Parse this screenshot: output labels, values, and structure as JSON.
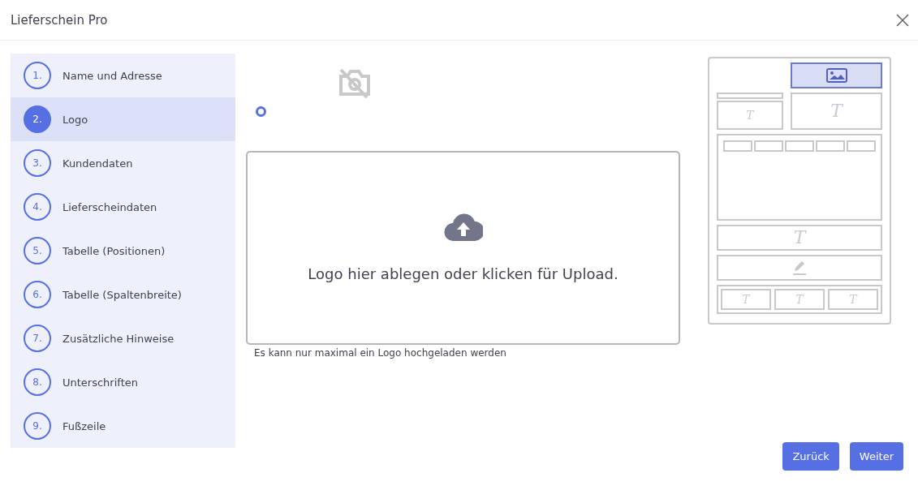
{
  "window": {
    "title": "Lieferschein Pro"
  },
  "steps": [
    {
      "number": "1.",
      "label": "Name und Adresse",
      "selected": false
    },
    {
      "number": "2.",
      "label": "Logo",
      "selected": true
    },
    {
      "number": "3.",
      "label": "Kundendaten",
      "selected": false
    },
    {
      "number": "4.",
      "label": "Lieferscheindaten",
      "selected": false
    },
    {
      "number": "5.",
      "label": "Tabelle (Positionen)",
      "selected": false
    },
    {
      "number": "6.",
      "label": "Tabelle (Spaltenbreite)",
      "selected": false
    },
    {
      "number": "7.",
      "label": "Zusätzliche Hinweise",
      "selected": false
    },
    {
      "number": "8.",
      "label": "Unterschriften",
      "selected": false
    },
    {
      "number": "9.",
      "label": "Fußzeile",
      "selected": false
    }
  ],
  "logo_option": {
    "selected": true
  },
  "dropzone": {
    "text": "Logo hier ablegen oder klicken für Upload."
  },
  "hint": "Es kann nur maximal ein Logo hochgeladen werden",
  "preview": {
    "logo_highlighted": true,
    "marks": [
      "T",
      "T",
      "T",
      "T",
      "T",
      "T"
    ]
  },
  "buttons": [
    "Zurück",
    "Weiter"
  ]
}
